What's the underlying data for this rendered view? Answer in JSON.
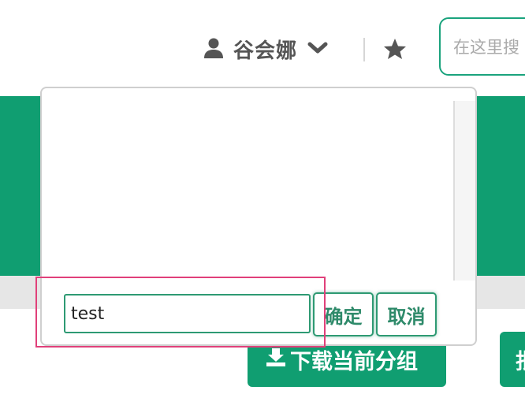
{
  "header": {
    "username": "谷会娜",
    "user_icon": "user-icon",
    "dropdown_icon": "chevron-down-icon",
    "star_icon": "star-icon",
    "search_placeholder": "在这里搜"
  },
  "toolbar": {
    "download_label": "下载当前分组",
    "download_icon": "download-icon",
    "edge_button_label": "批"
  },
  "popup": {
    "input_value": "test",
    "confirm_label": "确定",
    "cancel_label": "取消"
  },
  "colors": {
    "brand_green": "#109e71",
    "input_border": "#2e9a73",
    "highlight": "#e0407a"
  }
}
